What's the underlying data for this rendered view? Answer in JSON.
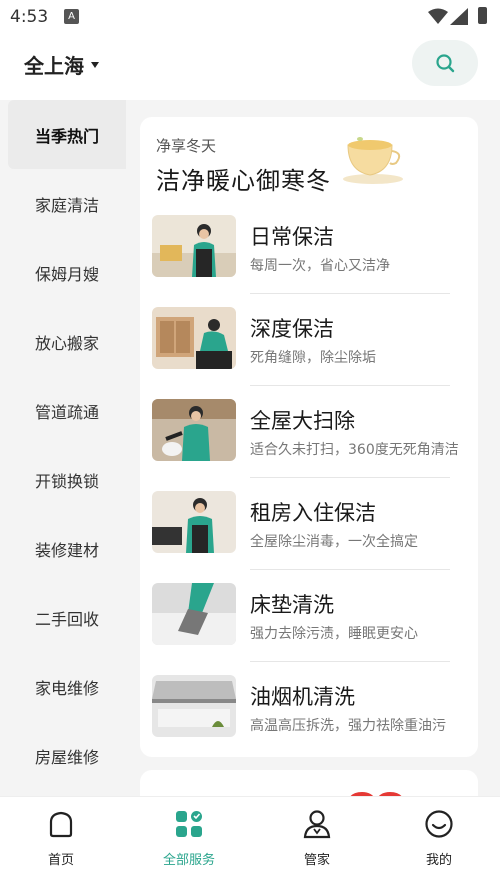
{
  "status_bar": {
    "time": "4:53",
    "badge": "A"
  },
  "header": {
    "city": "全上海"
  },
  "sidebar": {
    "items": [
      {
        "label": "当季热门",
        "active": true
      },
      {
        "label": "家庭清洁"
      },
      {
        "label": "保姆月嫂"
      },
      {
        "label": "放心搬家"
      },
      {
        "label": "管道疏通"
      },
      {
        "label": "开锁换锁"
      },
      {
        "label": "装修建材"
      },
      {
        "label": "二手回收"
      },
      {
        "label": "家电维修"
      },
      {
        "label": "房屋维修"
      }
    ]
  },
  "featured": {
    "subtitle": "净享冬天",
    "title": "洁净暖心御寒冬",
    "services": [
      {
        "name": "日常保洁",
        "desc": "每周一次，省心又洁净"
      },
      {
        "name": "深度保洁",
        "desc": "死角缝隙，除尘除垢"
      },
      {
        "name": "全屋大扫除",
        "desc": "适合久未打扫，360度无死角清洁"
      },
      {
        "name": "租房入住保洁",
        "desc": "全屋除尘消毒，一次全搞定"
      },
      {
        "name": "床垫清洗",
        "desc": "强力去除污渍，睡眠更安心"
      },
      {
        "name": "油烟机清洗",
        "desc": "高温高压拆洗，强力祛除重油污"
      }
    ]
  },
  "tabbar": {
    "items": [
      {
        "label": "首页"
      },
      {
        "label": "全部服务",
        "active": true
      },
      {
        "label": "管家"
      },
      {
        "label": "我的"
      }
    ]
  },
  "colors": {
    "accent": "#2aa58d",
    "background": "#f4f4f4"
  }
}
